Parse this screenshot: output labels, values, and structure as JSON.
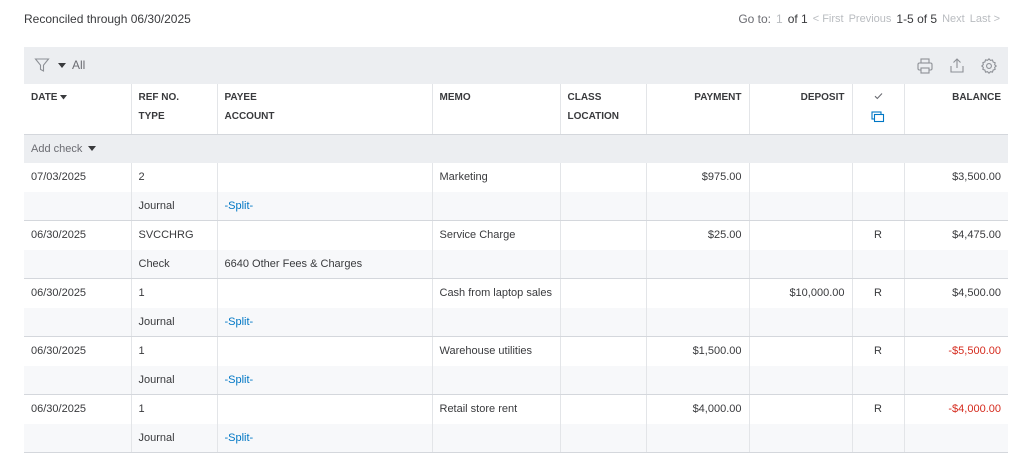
{
  "header": {
    "reconciled_text": "Reconciled through 06/30/2025",
    "goto_label": "Go to:",
    "page_current": "1",
    "page_of": "of 1",
    "first": "< First",
    "previous": "Previous",
    "range": "1-5 of 5",
    "next": "Next",
    "last": "Last >"
  },
  "toolbar": {
    "filter_value": "All",
    "icons": [
      "filter-icon",
      "print-icon",
      "export-icon",
      "settings-icon"
    ]
  },
  "columns": {
    "date": "DATE",
    "ref_no": "REF NO.",
    "type": "TYPE",
    "payee": "PAYEE",
    "account": "ACCOUNT",
    "memo": "MEMO",
    "class": "CLASS",
    "location": "LOCATION",
    "payment": "PAYMENT",
    "deposit": "DEPOSIT",
    "balance": "BALANCE"
  },
  "add_check_label": "Add check",
  "rows": [
    {
      "date": "07/03/2025",
      "ref": "2",
      "type": "Journal",
      "payee": "",
      "account": "-Split-",
      "memo": "Marketing",
      "payment": "$975.00",
      "deposit": "",
      "status": "",
      "balance": "$3,500.00"
    },
    {
      "date": "06/30/2025",
      "ref": "SVCCHRG",
      "type": "Check",
      "payee": "",
      "account": "6640 Other Fees & Charges",
      "memo": "Service Charge",
      "payment": "$25.00",
      "deposit": "",
      "status": "R",
      "balance": "$4,475.00"
    },
    {
      "date": "06/30/2025",
      "ref": "1",
      "type": "Journal",
      "payee": "",
      "account": "-Split-",
      "memo": "Cash from laptop sales",
      "payment": "",
      "deposit": "$10,000.00",
      "status": "R",
      "balance": "$4,500.00"
    },
    {
      "date": "06/30/2025",
      "ref": "1",
      "type": "Journal",
      "payee": "",
      "account": "-Split-",
      "memo": "Warehouse utilities",
      "payment": "$1,500.00",
      "deposit": "",
      "status": "R",
      "balance": "-$5,500.00"
    },
    {
      "date": "06/30/2025",
      "ref": "1",
      "type": "Journal",
      "payee": "",
      "account": "-Split-",
      "memo": "Retail store rent",
      "payment": "$4,000.00",
      "deposit": "",
      "status": "R",
      "balance": "-$4,000.00"
    }
  ]
}
